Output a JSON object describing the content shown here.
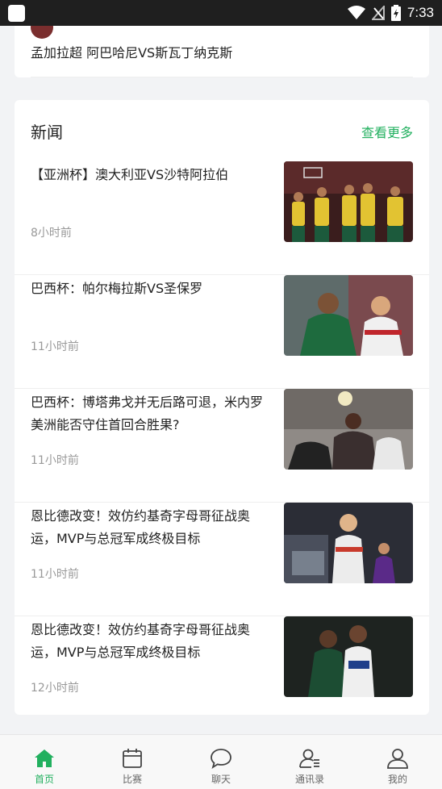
{
  "status_bar": {
    "time": "7:33"
  },
  "top_card": {
    "match": "孟加拉超 阿巴哈尼VS斯瓦丁纳克斯"
  },
  "news": {
    "title": "新闻",
    "more_label": "查看更多",
    "items": [
      {
        "headline": "【亚洲杯】澳大利亚VS沙特阿拉伯",
        "time": "8小时前",
        "thumb_icon": "basketball-players-image"
      },
      {
        "headline": "巴西杯：帕尔梅拉斯VS圣保罗",
        "time": "11小时前",
        "thumb_icon": "football-players-image"
      },
      {
        "headline": "巴西杯：博塔弗戈并无后路可退，米内罗美洲能否守住首回合胜果?",
        "time": "11小时前",
        "thumb_icon": "football-header-image"
      },
      {
        "headline": "恩比德改变！效仿约基奇字母哥征战奥运，MVP与总冠军成终极目标",
        "time": "11小时前",
        "thumb_icon": "basketball-player-image"
      },
      {
        "headline": "恩比德改变！效仿约基奇字母哥征战奥运，MVP与总冠军成终极目标",
        "time": "12小时前",
        "thumb_icon": "basketball-match-image"
      }
    ]
  },
  "tabbar": {
    "tabs": [
      {
        "label": "首页",
        "icon": "home-icon"
      },
      {
        "label": "比赛",
        "icon": "calendar-icon"
      },
      {
        "label": "聊天",
        "icon": "chat-icon"
      },
      {
        "label": "通讯录",
        "icon": "contacts-icon"
      },
      {
        "label": "我的",
        "icon": "profile-icon"
      }
    ]
  },
  "colors": {
    "accent": "#22b05f",
    "status_bar": "#1f1f1f"
  }
}
